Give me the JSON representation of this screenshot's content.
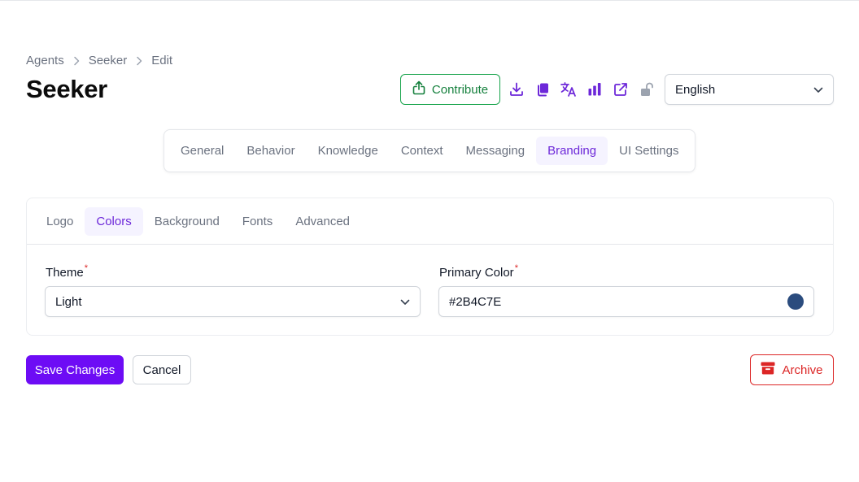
{
  "breadcrumb": {
    "items": [
      "Agents",
      "Seeker",
      "Edit"
    ]
  },
  "page": {
    "title": "Seeker"
  },
  "toolbar": {
    "contribute_label": "Contribute",
    "icons": [
      "download-icon",
      "copy-icon",
      "translate-icon",
      "analytics-icon",
      "external-link-icon",
      "unlock-icon"
    ]
  },
  "language": {
    "selected": "English"
  },
  "main_tabs": {
    "items": [
      "General",
      "Behavior",
      "Knowledge",
      "Context",
      "Messaging",
      "Branding",
      "UI Settings"
    ],
    "active": "Branding"
  },
  "sub_tabs": {
    "items": [
      "Logo",
      "Colors",
      "Background",
      "Fonts",
      "Advanced"
    ],
    "active": "Colors"
  },
  "form": {
    "theme_label": "Theme",
    "theme_value": "Light",
    "primary_color_label": "Primary Color",
    "primary_color_value": "#2B4C7E",
    "required_marker": "*"
  },
  "footer": {
    "save_label": "Save Changes",
    "cancel_label": "Cancel",
    "archive_label": "Archive"
  },
  "colors": {
    "accent": "#6d28d9",
    "primary_button": "#6d0cf5",
    "contribute": "#15803d",
    "danger": "#dc2626",
    "swatch": "#2B4C7E"
  }
}
